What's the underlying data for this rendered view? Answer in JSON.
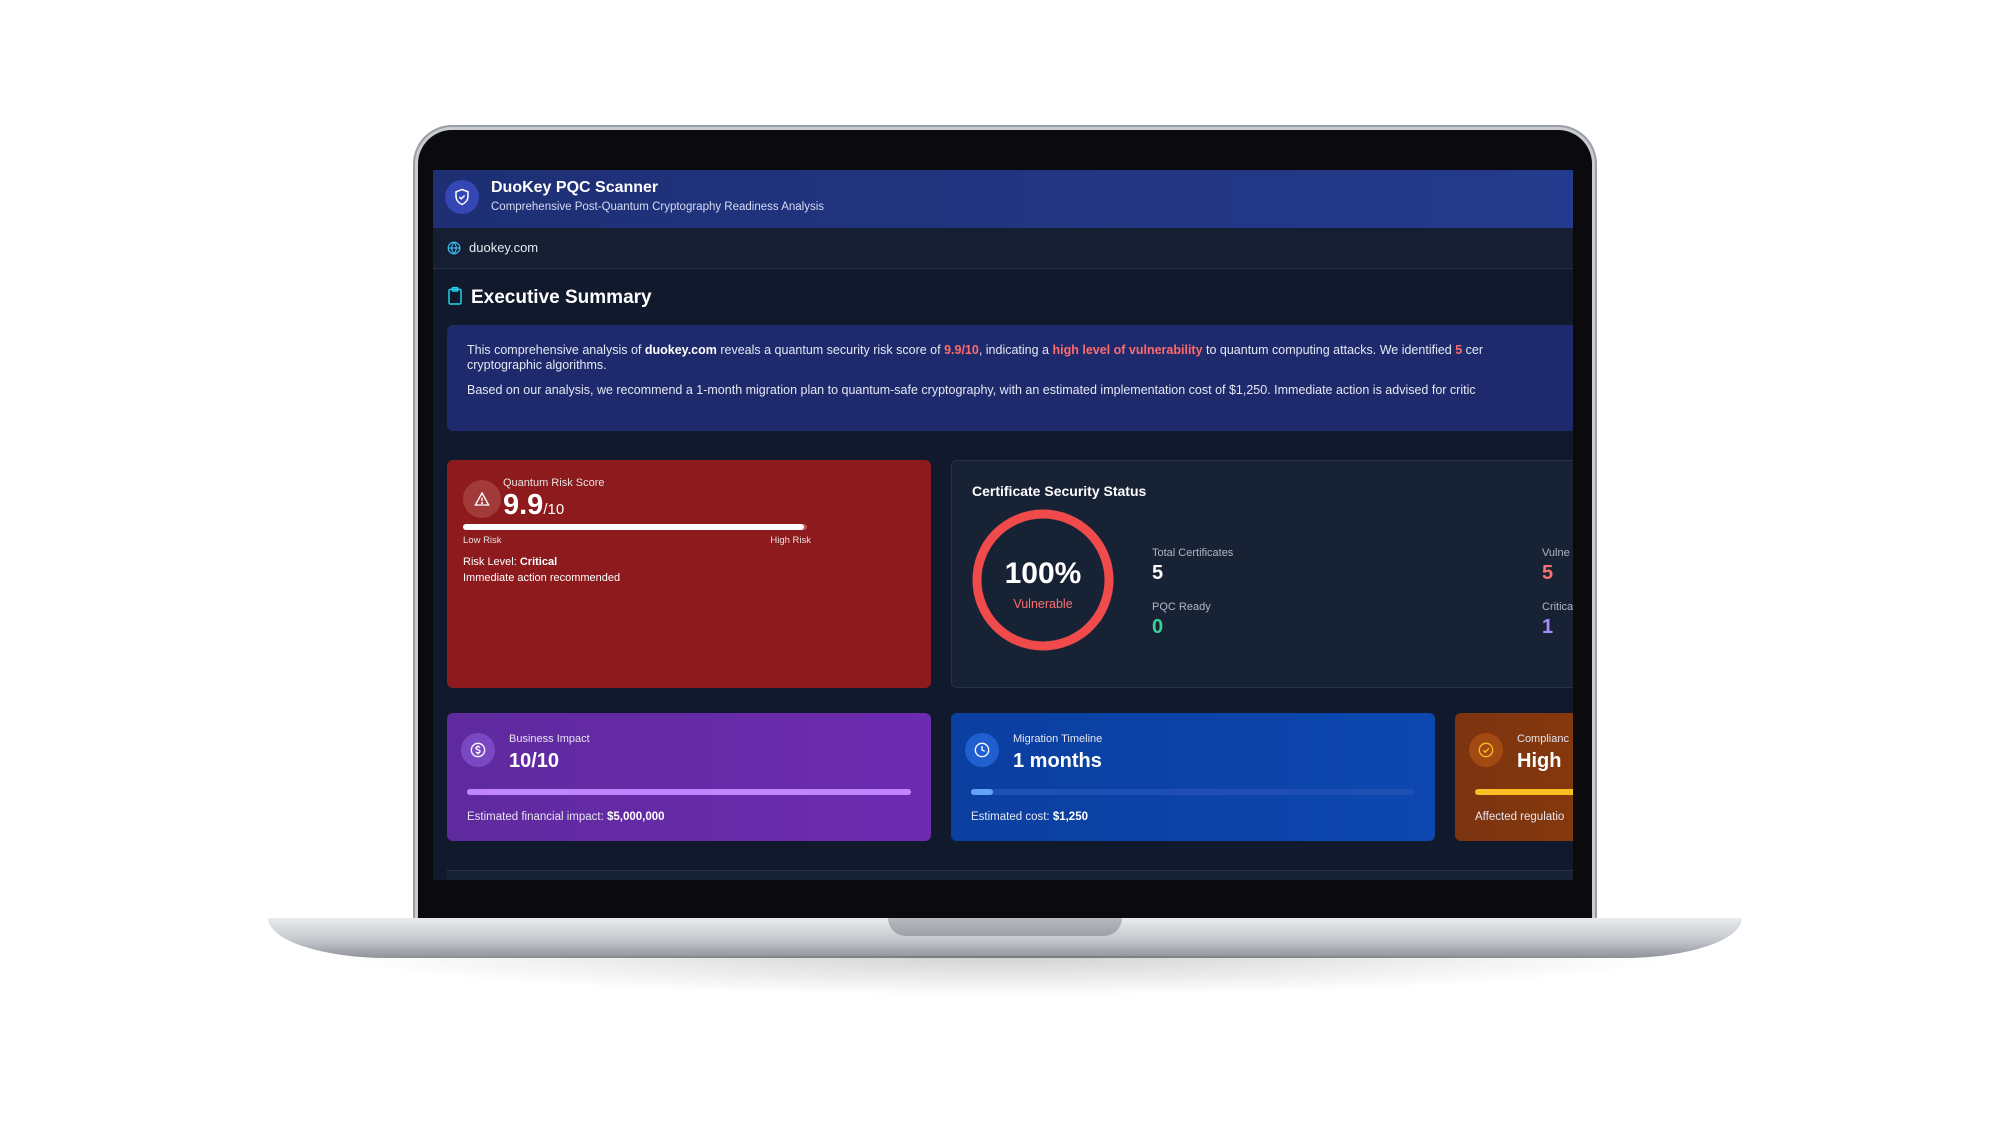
{
  "app": {
    "title": "DuoKey PQC Scanner",
    "subtitle": "Comprehensive Post-Quantum Cryptography Readiness Analysis",
    "domain": "duokey.com"
  },
  "summary": {
    "title": "Executive Summary",
    "p1_a": "This comprehensive analysis of ",
    "p1_domain": "duokey.com",
    "p1_b": " reveals a quantum security risk score of ",
    "p1_score": "9.9/10",
    "p1_c": ", indicating a ",
    "p1_level": "high level of vulnerability",
    "p1_d": " to quantum computing attacks. We identified ",
    "p1_count": "5",
    "p1_e": " cer",
    "p1_line2": "cryptographic algorithms.",
    "p2": "Based on our analysis, we recommend a 1-month migration plan to quantum-safe cryptography, with an estimated implementation cost of $1,250. Immediate action is advised for critic"
  },
  "risk": {
    "label": "Quantum Risk Score",
    "value": "9.9",
    "suffix": "/10",
    "score_fraction": 0.99,
    "low_label": "Low Risk",
    "high_label": "High Risk",
    "level_prefix": "Risk Level: ",
    "level": "Critical",
    "note": "Immediate action recommended"
  },
  "certs": {
    "title": "Certificate Security Status",
    "percent": "100%",
    "percent_label": "Vulnerable",
    "total_label": "Total Certificates",
    "total": "5",
    "pqc_label": "PQC Ready",
    "pqc": "0",
    "vuln_label": "Vulne",
    "vuln": "5",
    "crit_label": "Critica",
    "crit": "1"
  },
  "business": {
    "label": "Business Impact",
    "value": "10/10",
    "fill_fraction": 1.0,
    "foot_prefix": "Estimated financial impact: ",
    "foot_value": "$5,000,000"
  },
  "migration": {
    "label": "Migration Timeline",
    "value": "1 months",
    "fill_fraction": 0.05,
    "foot_prefix": "Estimated cost: ",
    "foot_value": "$1,250"
  },
  "compliance": {
    "label": "Complianc",
    "value": "High",
    "foot": "Affected regulatio"
  },
  "colors": {
    "risk_red": "#8d1a1c",
    "ring_red": "#f04a4a",
    "pqc_green": "#34d399",
    "crit_purple": "#a78bfa",
    "business_purple": "#6a2aa8",
    "migration_blue": "#0b43a6",
    "compliance_orange": "#8a3a0a"
  }
}
